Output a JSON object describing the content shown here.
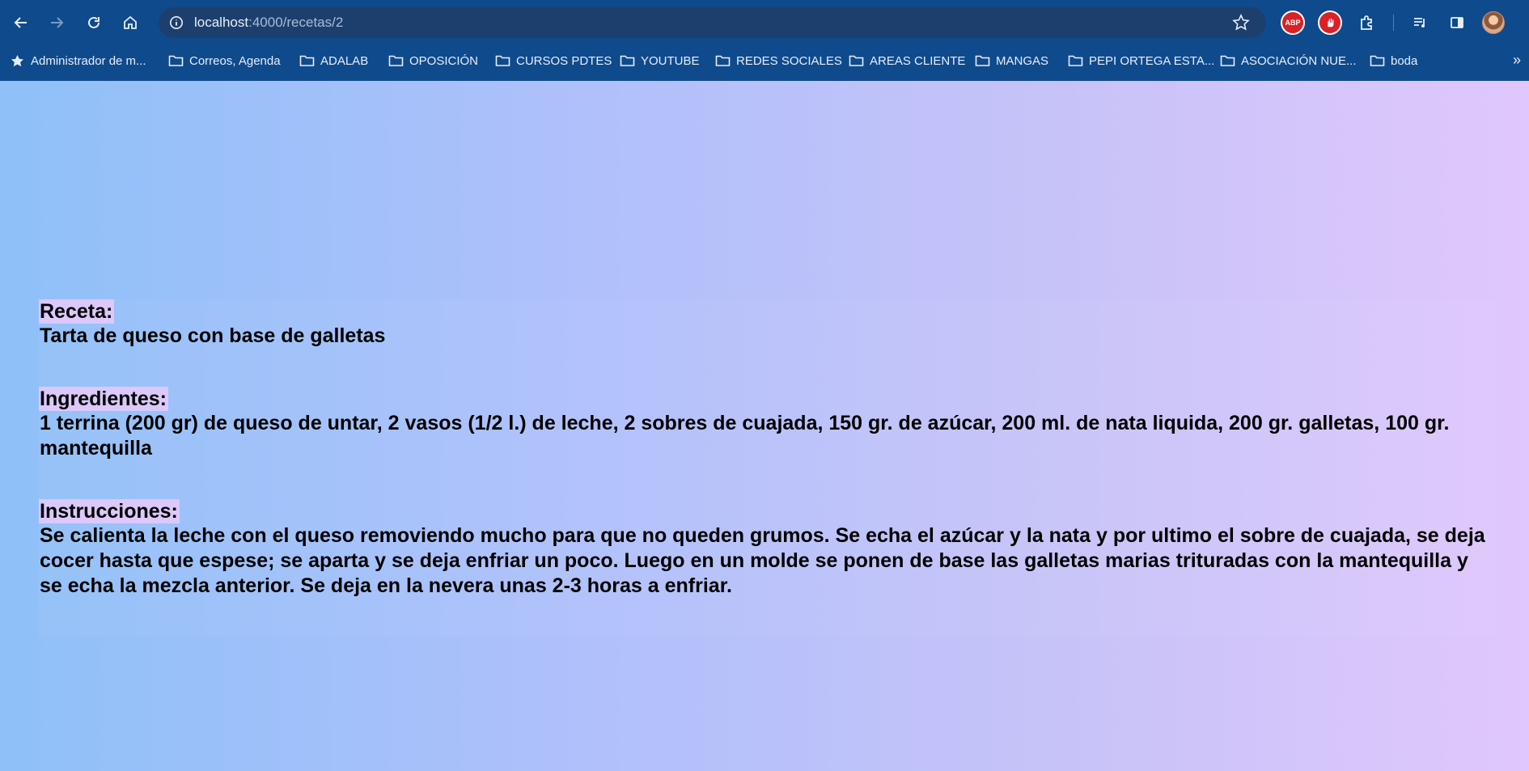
{
  "browser": {
    "url_host": "localhost",
    "url_path": ":4000/recetas/2",
    "colors": {
      "chrome": "#0f4a8c",
      "omnibox": "#1d3f6e"
    },
    "extensions": {
      "abp_label": "ABP"
    },
    "bookmarks": [
      {
        "label": "Administrador de m...",
        "icon": "star-icon"
      },
      {
        "label": "Correos, Agenda",
        "icon": "folder-icon"
      },
      {
        "label": "ADALAB",
        "icon": "folder-icon"
      },
      {
        "label": "OPOSICIÓN",
        "icon": "folder-icon"
      },
      {
        "label": "CURSOS PDTES",
        "icon": "folder-icon"
      },
      {
        "label": "YOUTUBE",
        "icon": "folder-icon"
      },
      {
        "label": "REDES SOCIALES",
        "icon": "folder-icon"
      },
      {
        "label": "AREAS CLIENTE",
        "icon": "folder-icon"
      },
      {
        "label": "MANGAS",
        "icon": "folder-icon"
      },
      {
        "label": "PEPI ORTEGA ESTA...",
        "icon": "folder-icon"
      },
      {
        "label": "ASOCIACIÓN NUE...",
        "icon": "folder-icon"
      },
      {
        "label": "boda",
        "icon": "folder-icon"
      }
    ],
    "more_label": "»"
  },
  "recipe": {
    "name_label": "Receta:",
    "name": "Tarta de queso con base de galletas",
    "ingredients_label": "Ingredientes:",
    "ingredients": "1 terrina (200 gr) de queso de untar, 2 vasos (1/2 l.) de leche, 2 sobres de cuajada, 150 gr. de azúcar, 200 ml. de nata liquida, 200 gr. galletas, 100 gr. mantequilla",
    "instructions_label": "Instrucciones:",
    "instructions": "Se calienta la leche con el queso removiendo mucho para que no queden grumos. Se echa el azúcar y la nata y por ultimo el sobre de cuajada, se deja cocer hasta que espese; se aparta y se deja enfriar un poco. Luego en un molde se ponen de base las galletas marias trituradas con la mantequilla y se echa la mezcla anterior. Se deja en la nevera unas 2-3 horas a enfriar."
  }
}
